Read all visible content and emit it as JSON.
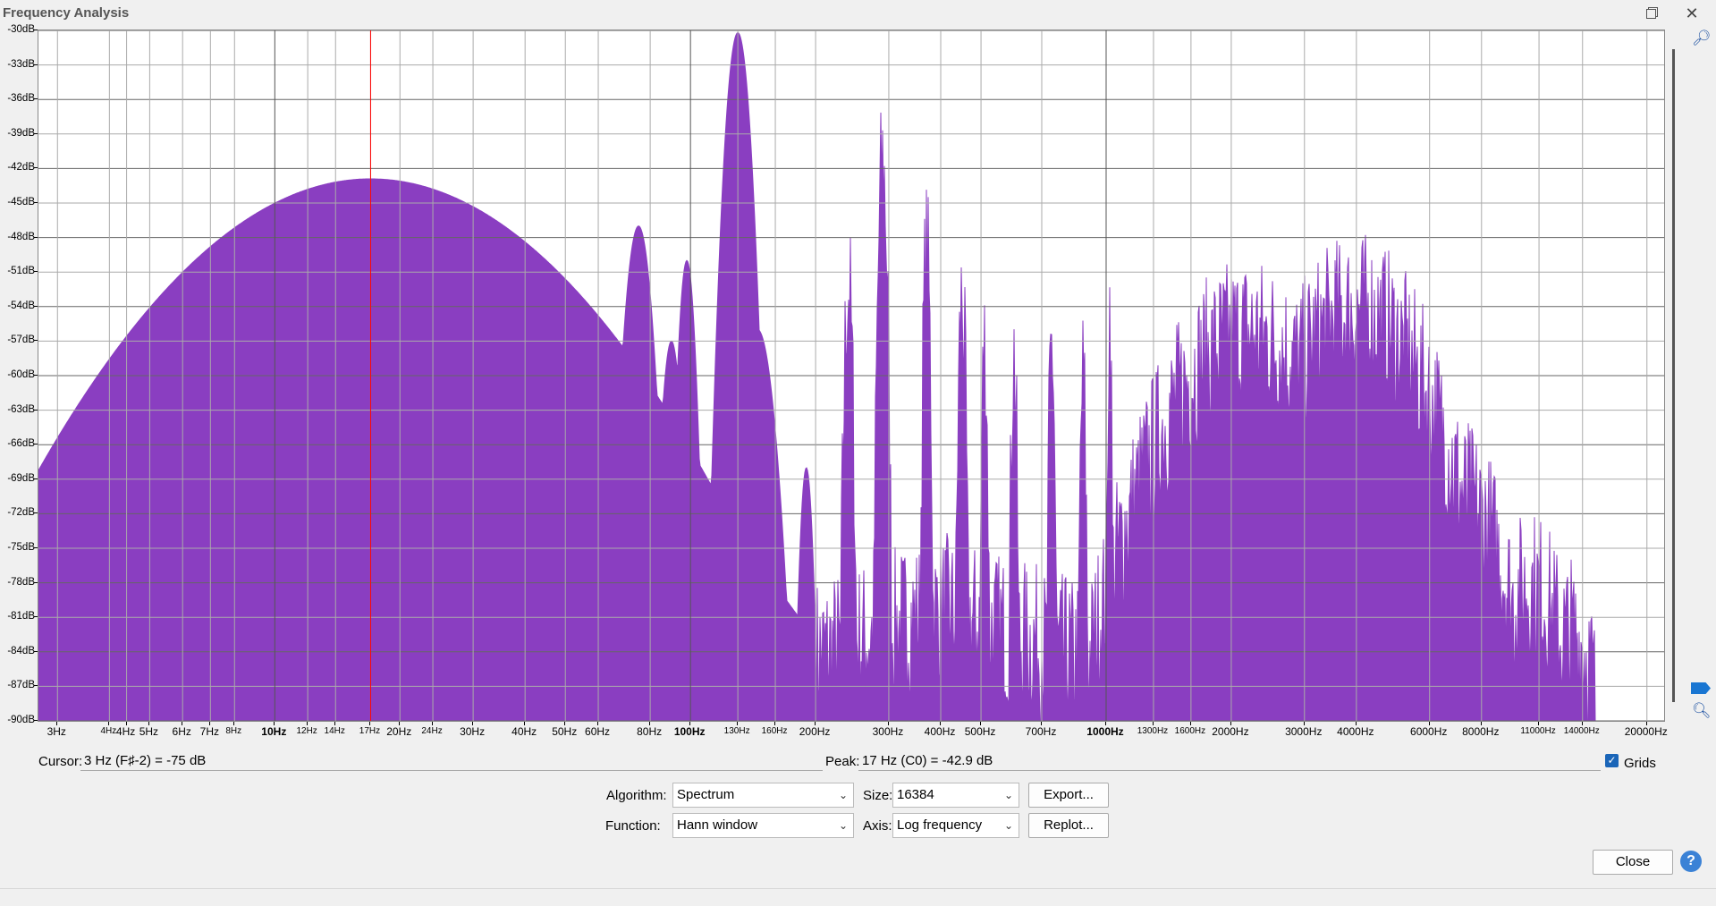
{
  "window": {
    "title": "Frequency Analysis",
    "restore_icon": "restore-icon",
    "close_icon": "close-icon"
  },
  "chart_data": {
    "type": "area",
    "xscale": "log",
    "xlim": [
      2.7,
      22000
    ],
    "ylim": [
      -90,
      -30
    ],
    "grid": true,
    "color": "#8a3ec1",
    "cursor_line_x": 17,
    "cursor_line_color": "#ff0000",
    "yticks": [
      "-30dB",
      "-33dB",
      "-36dB",
      "-39dB",
      "-42dB",
      "-45dB",
      "-48dB",
      "-51dB",
      "-54dB",
      "-57dB",
      "-60dB",
      "-63dB",
      "-66dB",
      "-69dB",
      "-72dB",
      "-75dB",
      "-78dB",
      "-81dB",
      "-84dB",
      "-87dB",
      "-90dB"
    ],
    "xticks": [
      {
        "v": 3,
        "label": "3Hz"
      },
      {
        "v": 4,
        "label": "4Hz",
        "minor": true
      },
      {
        "v": 4.4,
        "label": "4Hz"
      },
      {
        "v": 5,
        "label": "5Hz"
      },
      {
        "v": 6,
        "label": "6Hz"
      },
      {
        "v": 7,
        "label": "7Hz"
      },
      {
        "v": 8,
        "label": "8Hz",
        "minor": true
      },
      {
        "v": 10,
        "label": "10Hz",
        "dec": true
      },
      {
        "v": 12,
        "label": "12Hz",
        "minor": true
      },
      {
        "v": 14,
        "label": "14Hz",
        "minor": true
      },
      {
        "v": 17,
        "label": "17Hz",
        "minor": true
      },
      {
        "v": 20,
        "label": "20Hz"
      },
      {
        "v": 24,
        "label": "24Hz",
        "minor": true
      },
      {
        "v": 30,
        "label": "30Hz"
      },
      {
        "v": 40,
        "label": "40Hz"
      },
      {
        "v": 50,
        "label": "50Hz"
      },
      {
        "v": 60,
        "label": "60Hz"
      },
      {
        "v": 80,
        "label": "80Hz"
      },
      {
        "v": 100,
        "label": "100Hz",
        "dec": true
      },
      {
        "v": 130,
        "label": "130Hz",
        "minor": true
      },
      {
        "v": 160,
        "label": "160Hz",
        "minor": true
      },
      {
        "v": 200,
        "label": "200Hz"
      },
      {
        "v": 300,
        "label": "300Hz"
      },
      {
        "v": 400,
        "label": "400Hz"
      },
      {
        "v": 500,
        "label": "500Hz"
      },
      {
        "v": 700,
        "label": "700Hz"
      },
      {
        "v": 1000,
        "label": "1000Hz",
        "dec": true
      },
      {
        "v": 1300,
        "label": "1300Hz",
        "minor": true
      },
      {
        "v": 1600,
        "label": "1600Hz",
        "minor": true
      },
      {
        "v": 2000,
        "label": "2000Hz"
      },
      {
        "v": 3000,
        "label": "3000Hz"
      },
      {
        "v": 4000,
        "label": "4000Hz"
      },
      {
        "v": 6000,
        "label": "6000Hz"
      },
      {
        "v": 8000,
        "label": "8000Hz"
      },
      {
        "v": 11000,
        "label": "11000Hz",
        "minor": true
      },
      {
        "v": 14000,
        "label": "14000Hz",
        "minor": true
      },
      {
        "v": 20000,
        "label": "20000Hz"
      }
    ],
    "peaks": [
      {
        "f": 17,
        "db": -42.9,
        "w": 0.55
      },
      {
        "f": 21,
        "db": -45,
        "w": 0.25
      },
      {
        "f": 31,
        "db": -53.5,
        "w": 0.1
      },
      {
        "f": 41,
        "db": -55.5,
        "w": 0.06
      },
      {
        "f": 46,
        "db": -65,
        "w": 0.05
      },
      {
        "f": 55,
        "db": -54,
        "w": 0.035
      },
      {
        "f": 75,
        "db": -47,
        "w": 0.04
      },
      {
        "f": 80,
        "db": -66,
        "w": 0.05
      },
      {
        "f": 90,
        "db": -57,
        "w": 0.03
      },
      {
        "f": 98,
        "db": -50,
        "w": 0.025
      },
      {
        "f": 130,
        "db": -30.2,
        "w": 0.035
      },
      {
        "f": 145,
        "db": -56,
        "w": 0.05
      },
      {
        "f": 190,
        "db": -68,
        "w": 0.02
      },
      {
        "f": 240,
        "db": -51,
        "w": 0.012
      },
      {
        "f": 290,
        "db": -40.2,
        "w": 0.012
      },
      {
        "f": 370,
        "db": -48,
        "w": 0.01
      },
      {
        "f": 450,
        "db": -52,
        "w": 0.01
      },
      {
        "f": 510,
        "db": -56,
        "w": 0.008
      },
      {
        "f": 600,
        "db": -57,
        "w": 0.008
      },
      {
        "f": 740,
        "db": -56,
        "w": 0.008
      },
      {
        "f": 880,
        "db": -59,
        "w": 0.008
      },
      {
        "f": 1020,
        "db": -52.7,
        "w": 0.005
      },
      {
        "f": 2200,
        "db": -55,
        "w": 0.25
      },
      {
        "f": 4000,
        "db": -53,
        "w": 0.22
      },
      {
        "f": 7000,
        "db": -69,
        "w": 0.15
      },
      {
        "f": 10500,
        "db": -77,
        "w": 0.12
      },
      {
        "f": 13000,
        "db": -81,
        "w": 0.1
      }
    ],
    "baseline": [
      [
        2.7,
        -79
      ],
      [
        3,
        -77.5
      ],
      [
        5,
        -71.5
      ],
      [
        8,
        -67.5
      ],
      [
        10,
        -60
      ],
      [
        20,
        -53
      ],
      [
        40,
        -70
      ],
      [
        60,
        -76
      ],
      [
        120,
        -72
      ],
      [
        200,
        -83
      ],
      [
        400,
        -79
      ],
      [
        1000,
        -84
      ],
      [
        1600,
        -88
      ],
      [
        2500,
        -72
      ],
      [
        4500,
        -71
      ],
      [
        8000,
        -80
      ],
      [
        12000,
        -88
      ],
      [
        15000,
        -89.9
      ]
    ]
  },
  "cursor": {
    "label": "Cursor:",
    "value": "3 Hz (F♯-2) = -75 dB"
  },
  "peak": {
    "label": "Peak:",
    "value": "17 Hz (C0) = -42.9 dB"
  },
  "grids": {
    "label": "Grids",
    "checked": true
  },
  "algorithm": {
    "label": "Algorithm:",
    "value": "Spectrum"
  },
  "function": {
    "label": "Function:",
    "value": "Hann window"
  },
  "size": {
    "label": "Size:",
    "value": "16384"
  },
  "axis": {
    "label": "Axis:",
    "value": "Log frequency"
  },
  "buttons": {
    "export": "Export...",
    "replot": "Replot...",
    "close": "Close",
    "help": "?"
  }
}
